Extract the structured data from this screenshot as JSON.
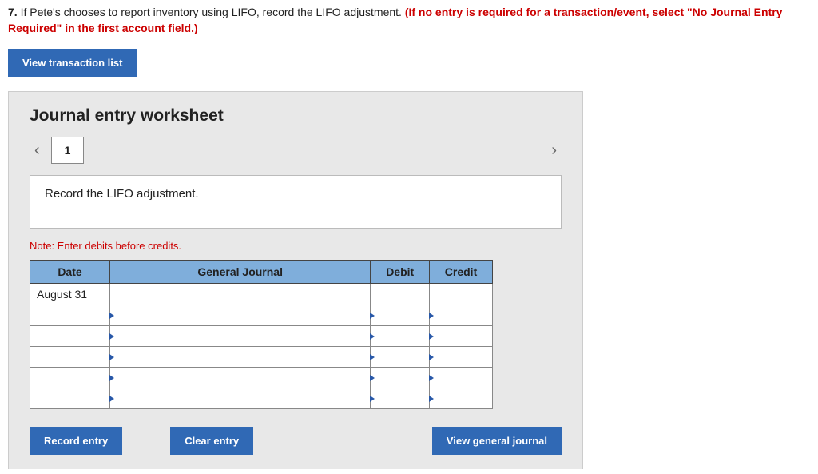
{
  "question": {
    "number": "7.",
    "text": " If Pete's chooses to report inventory using LIFO, record the LIFO adjustment. ",
    "hint": "(If no entry is required for a transaction/event, select \"No Journal Entry Required\" in the first account field.)"
  },
  "buttons": {
    "view_transaction_list": "View transaction list",
    "record_entry": "Record entry",
    "clear_entry": "Clear entry",
    "view_general_journal": "View general journal"
  },
  "worksheet": {
    "title": "Journal entry worksheet",
    "active_tab": "1",
    "instruction": "Record the LIFO adjustment.",
    "note": "Note: Enter debits before credits."
  },
  "table": {
    "headers": {
      "date": "Date",
      "general_journal": "General Journal",
      "debit": "Debit",
      "credit": "Credit"
    },
    "rows": [
      {
        "date": "August 31",
        "general_journal": "",
        "debit": "",
        "credit": ""
      },
      {
        "date": "",
        "general_journal": "",
        "debit": "",
        "credit": ""
      },
      {
        "date": "",
        "general_journal": "",
        "debit": "",
        "credit": ""
      },
      {
        "date": "",
        "general_journal": "",
        "debit": "",
        "credit": ""
      },
      {
        "date": "",
        "general_journal": "",
        "debit": "",
        "credit": ""
      },
      {
        "date": "",
        "general_journal": "",
        "debit": "",
        "credit": ""
      }
    ]
  }
}
